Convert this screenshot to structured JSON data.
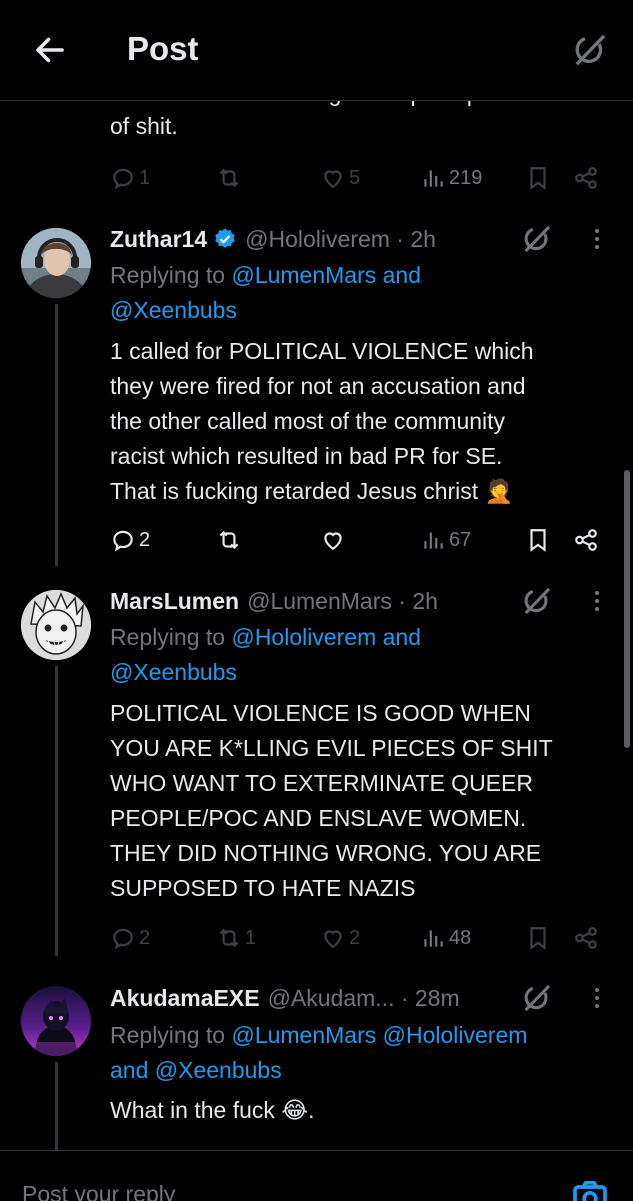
{
  "header": {
    "title": "Post"
  },
  "previous_post": {
    "cut_line": "harasser without being a complete piece",
    "last_line": "of shit.",
    "stats": {
      "replies": "1",
      "reposts": "",
      "likes": "5",
      "views": "219"
    }
  },
  "posts": [
    {
      "display_name": "Zuthar14",
      "handle": "@Hololiverem · 2h",
      "verified": true,
      "replying_label": "Replying to ",
      "replying_mentions": "@LumenMars and",
      "replying_mentions_2": "@Xeenbubs",
      "body_lines": [
        "1 called for POLITICAL VIOLENCE which",
        "they were fired for not an accusation and",
        "the other called most of the community",
        "racist which resulted in bad PR for SE.",
        "That is fucking retarded Jesus christ 🤦"
      ],
      "stats": {
        "replies": "2",
        "reposts": "",
        "likes": "",
        "views": "67"
      }
    },
    {
      "display_name": "MarsLumen",
      "handle": "@LumenMars · 2h",
      "verified": false,
      "replying_label": "Replying to ",
      "replying_mentions": "@Hololiverem and",
      "replying_mentions_2": "@Xeenbubs",
      "body_lines": [
        "POLITICAL VIOLENCE IS GOOD WHEN",
        "YOU ARE K*LLING EVIL PIECES OF SHIT",
        "WHO WANT TO EXTERMINATE QUEER",
        "PEOPLE/POC AND ENSLAVE WOMEN.",
        "THEY DID NOTHING WRONG. YOU ARE",
        "SUPPOSED TO HATE NAZIS"
      ],
      "stats": {
        "replies": "2",
        "reposts": "1",
        "likes": "2",
        "views": "48"
      }
    },
    {
      "display_name": "AkudamaEXE",
      "handle": "@Akudam... · 28m",
      "verified": false,
      "replying_label": "Replying to ",
      "replying_mentions": "@LumenMars @Hololiverem",
      "replying_mentions_2": "and @Xeenbubs",
      "body_lines": [
        "What in the fuck 😂."
      ]
    }
  ],
  "composer": {
    "placeholder": "Post your reply"
  },
  "colors": {
    "background": "#000000",
    "text": "#e7e9ea",
    "muted": "#71767b",
    "link": "#1d9bf0",
    "border": "#2f3336"
  },
  "icons": [
    "back-arrow-icon",
    "grok-icon",
    "reply-icon",
    "repost-icon",
    "like-icon",
    "views-icon",
    "bookmark-icon",
    "share-icon",
    "more-icon",
    "verified-icon",
    "camera-icon"
  ]
}
